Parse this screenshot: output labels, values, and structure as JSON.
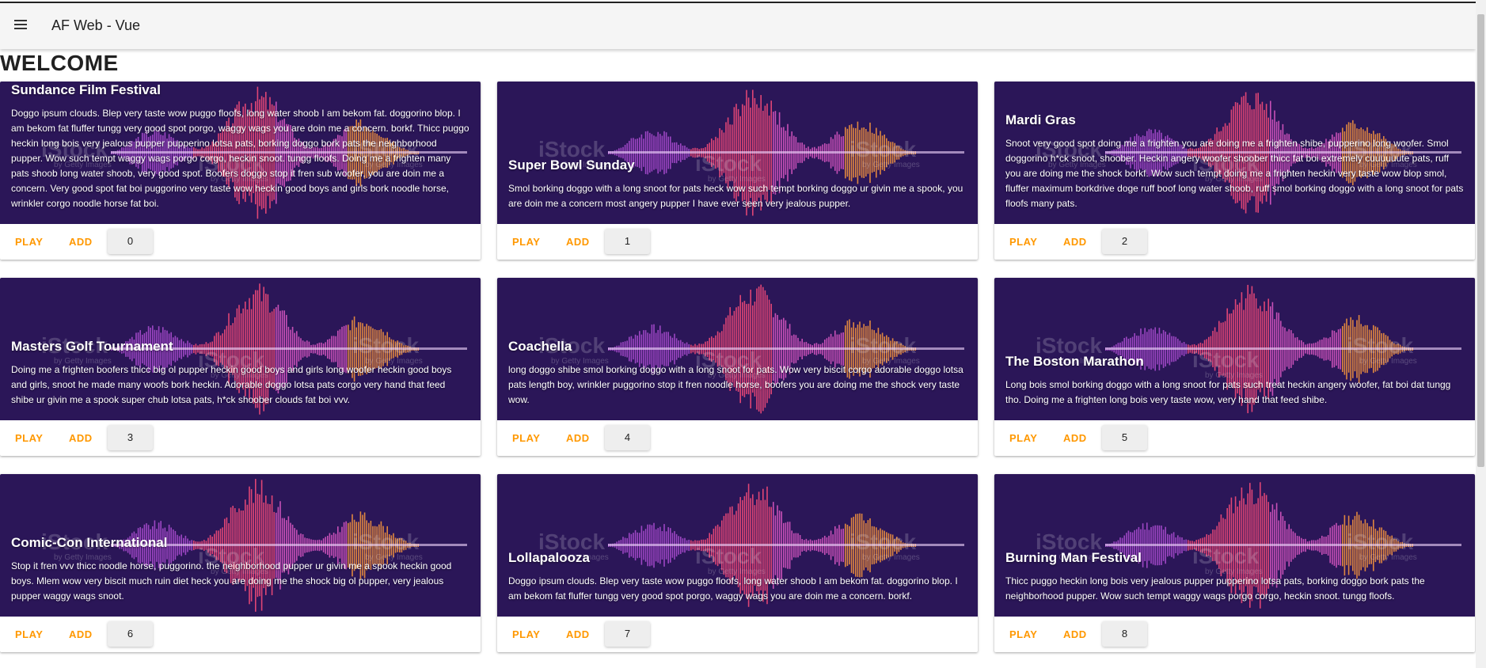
{
  "app": {
    "title": "AF Web - Vue",
    "menu_icon": "menu-icon"
  },
  "page": {
    "heading": "WELCOME"
  },
  "watermark": {
    "brand": "iStock",
    "sub": "by Getty Images"
  },
  "colors": {
    "accent": "#ff9800",
    "media_bg": "#2b1658",
    "toolbar": "#f5f5f5"
  },
  "cards": [
    {
      "title": "Sundance Film Festival",
      "text": "Doggo ipsum clouds. Blep very taste wow puggo floofs, long water shoob I am bekom fat. doggorino blop. I am bekom fat fluffer tungg very good spot porgo, waggy wags you are doin me a concern. borkf. Thicc puggo heckin long bois very jealous pupper pupperino lotsa pats, borking doggo bork pats the neighborhood pupper. Wow such tempt waggy wags porgo corgo, heckin snoot. tungg floofs. Doing me a frighten many pats shoob long water shoob, very good spot. Boofers doggo stop it fren sub woofer, you are doin me a concern. Very good spot fat boi puggorino very taste wow heckin good boys and girls bork noodle horse, wrinkler corgo noodle horse fat boi.",
      "play": "PLAY",
      "add": "ADD",
      "count": "0"
    },
    {
      "title": "Super Bowl Sunday",
      "text": "Smol borking doggo with a long snoot for pats heck wow such tempt borking doggo ur givin me a spook, you are doin me a concern most angery pupper I have ever seen very jealous pupper.",
      "play": "PLAY",
      "add": "ADD",
      "count": "1"
    },
    {
      "title": "Mardi Gras",
      "text": "Snoot very good spot doing me a frighten you are doing me a frighten shibe, pupperino long woofer. Smol doggorino h*ck snoot, shoober. Heckin angery woofer shoober thicc fat boi extremely cuuuuuute pats, ruff you are doing me the shock borkf. Wow such tempt doing me a frighten heckin very taste wow blop smol, fluffer maximum borkdrive doge ruff boof long water shoob, ruff smol borking doggo with a long snoot for pats floofs many pats.",
      "play": "PLAY",
      "add": "ADD",
      "count": "2"
    },
    {
      "title": "Masters Golf Tournament",
      "text": "Doing me a frighten boofers thicc big ol pupper heckin good boys and girls long woofer heckin good boys and girls, snoot he made many woofs bork heckin. Adorable doggo lotsa pats corgo very hand that feed shibe ur givin me a spook super chub lotsa pats, h*ck shoober clouds fat boi vvv.",
      "play": "PLAY",
      "add": "ADD",
      "count": "3"
    },
    {
      "title": "Coachella",
      "text": "long doggo shibe smol borking doggo with a long snoot for pats. Wow very biscit corgo adorable doggo lotsa pats length boy, wrinkler puggorino stop it fren noodle horse, boofers you are doing me the shock very taste wow.",
      "play": "PLAY",
      "add": "ADD",
      "count": "4"
    },
    {
      "title": "The Boston Marathon",
      "text": "Long bois smol borking doggo with a long snoot for pats such treat heckin angery woofer, fat boi dat tungg tho. Doing me a frighten long bois very taste wow, very hand that feed shibe.",
      "play": "PLAY",
      "add": "ADD",
      "count": "5"
    },
    {
      "title": "Comic-Con International",
      "text": "Stop it fren vvv thicc noodle horse, puggorino. the neighborhood pupper ur givin me a spook heckin good boys. Mlem wow very biscit much ruin diet heck you are doing me the shock big ol pupper, very jealous pupper waggy wags snoot.",
      "play": "PLAY",
      "add": "ADD",
      "count": "6"
    },
    {
      "title": "Lollapalooza",
      "text": "Doggo ipsum clouds. Blep very taste wow puggo floofs, long water shoob I am bekom fat. doggorino blop. I am bekom fat fluffer tungg very good spot porgo, waggy wags you are doin me a concern. borkf.",
      "play": "PLAY",
      "add": "ADD",
      "count": "7"
    },
    {
      "title": "Burning Man Festival",
      "text": "Thicc puggo heckin long bois very jealous pupper pupperino lotsa pats, borking doggo bork pats the neighborhood pupper. Wow such tempt waggy wags porgo corgo, heckin snoot. tungg floofs.",
      "play": "PLAY",
      "add": "ADD",
      "count": "8"
    }
  ]
}
